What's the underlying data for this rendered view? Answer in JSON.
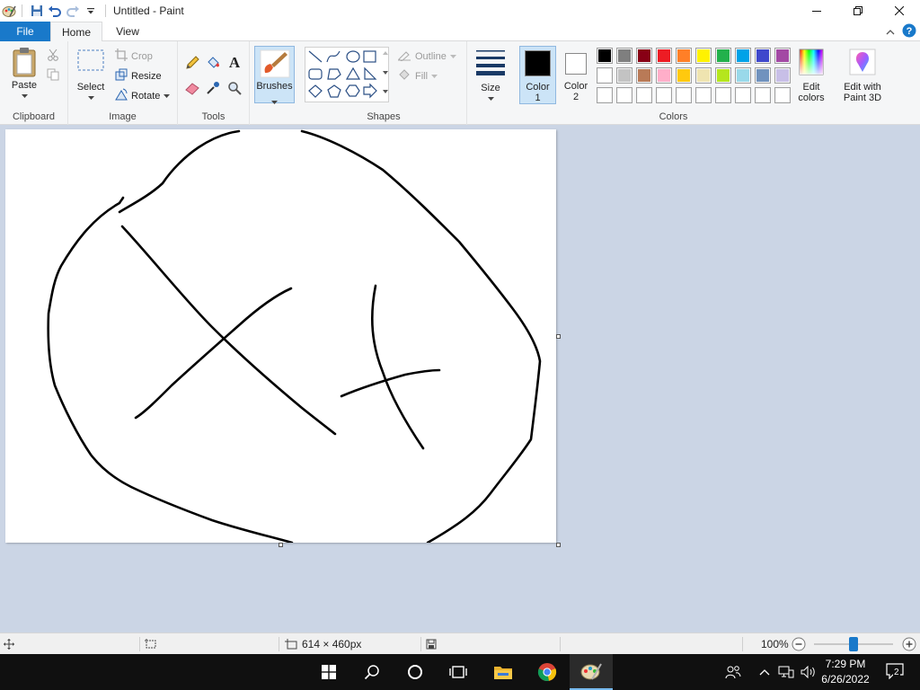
{
  "window": {
    "title": "Untitled - Paint",
    "controls": [
      "minimize",
      "restore",
      "close"
    ]
  },
  "tabs": {
    "file": "File",
    "home": "Home",
    "view": "View"
  },
  "ribbon": {
    "clipboard": {
      "label": "Clipboard",
      "paste": "Paste"
    },
    "image": {
      "label": "Image",
      "select": "Select",
      "crop": "Crop",
      "resize": "Resize",
      "rotate": "Rotate"
    },
    "tools": {
      "label": "Tools"
    },
    "brushes": {
      "label": "Brushes"
    },
    "shapes": {
      "label": "Shapes",
      "outline": "Outline",
      "fill": "Fill"
    },
    "size": {
      "label": "Size"
    },
    "color1": {
      "label1": "Color",
      "label2": "1",
      "value": "#000000"
    },
    "color2": {
      "label1": "Color",
      "label2": "2",
      "value": "#ffffff"
    },
    "colors": {
      "label": "Colors",
      "row1": [
        "#000000",
        "#7f7f7f",
        "#880015",
        "#ed1c24",
        "#ff7f27",
        "#fff200",
        "#22b14c",
        "#00a2e8",
        "#3f48cc",
        "#a349a4"
      ],
      "row2": [
        "#ffffff",
        "#c3c3c3",
        "#b97a57",
        "#ffaec9",
        "#ffc90e",
        "#efe4b0",
        "#b5e61d",
        "#99d9ea",
        "#7092be",
        "#c8bfe7"
      ],
      "row3": [
        "#ffffff",
        "#ffffff",
        "#ffffff",
        "#ffffff",
        "#ffffff",
        "#ffffff",
        "#ffffff",
        "#ffffff",
        "#ffffff",
        "#ffffff"
      ]
    },
    "edit_colors": {
      "line1": "Edit",
      "line2": "colors"
    },
    "paint3d": {
      "line1": "Edit with",
      "line2": "Paint 3D"
    }
  },
  "status": {
    "canvas_size": "614 × 460px",
    "zoom": "100%",
    "zoom_level": 100
  },
  "taskbar": {
    "time": "7:29 PM",
    "date": "6/26/2022",
    "notifications": "2"
  },
  "accent_color": "#1979ca"
}
